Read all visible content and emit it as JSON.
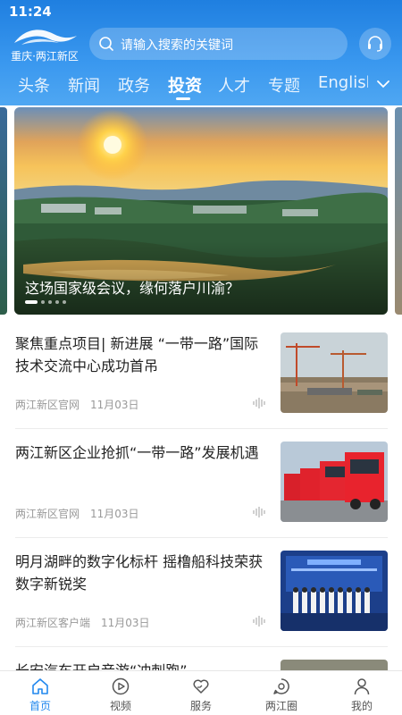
{
  "status_bar": {
    "time": "11:24"
  },
  "header": {
    "logo_text": "重庆·两江新区",
    "search_placeholder": "请输入搜索的关键词",
    "service_icon": "headset-icon"
  },
  "tabs": [
    {
      "label": "头条",
      "active": false
    },
    {
      "label": "新闻",
      "active": false
    },
    {
      "label": "政务",
      "active": false
    },
    {
      "label": "投资",
      "active": true
    },
    {
      "label": "人才",
      "active": false
    },
    {
      "label": "专题",
      "active": false
    },
    {
      "label": "English",
      "active": false
    }
  ],
  "tabs_more_icon": "chevron-down-icon",
  "carousel": {
    "caption": "这场国家级会议，缘何落户川渝？",
    "slide_count": 5,
    "active_index": 0
  },
  "news": [
    {
      "title": "聚焦重点项目| 新进展 “一带一路”国际技术交流中心成功首吊",
      "source": "两江新区官网",
      "date": "11月03日"
    },
    {
      "title": "两江新区企业抢抓“一带一路”发展机遇",
      "source": "两江新区官网",
      "date": "11月03日"
    },
    {
      "title": "明月湖畔的数字化标杆 摇橹船科技荣获数字新锐奖",
      "source": "两江新区客户端",
      "date": "11月03日"
    },
    {
      "title": "长安汽车开启音游“冲刺跑”",
      "source": "",
      "date": ""
    }
  ],
  "bottom_nav": [
    {
      "label": "首页",
      "icon": "home-icon",
      "active": true
    },
    {
      "label": "视频",
      "icon": "play-icon",
      "active": false
    },
    {
      "label": "服务",
      "icon": "heart-hand-icon",
      "active": false
    },
    {
      "label": "两江圈",
      "icon": "chat-circle-icon",
      "active": false
    },
    {
      "label": "我的",
      "icon": "user-icon",
      "active": false
    }
  ],
  "colors": {
    "header_blue": "#1f7fe0",
    "active_nav": "#2288ee",
    "meta_gray": "#999999"
  }
}
